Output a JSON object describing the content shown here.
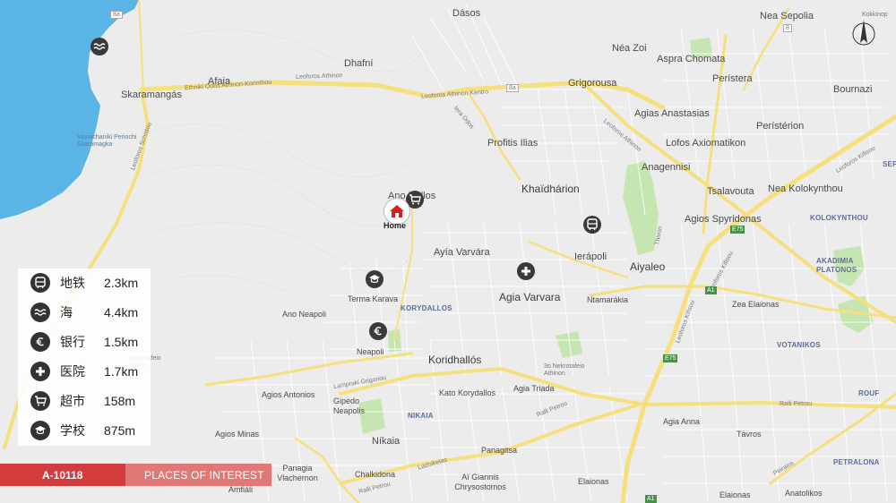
{
  "map": {
    "home_label": "Home",
    "colors": {
      "land": "#ececec",
      "sea": "#5bb4e6",
      "road": "#f6e07e",
      "park": "#bfe3a8",
      "accent": "#d23c3c"
    },
    "places": {
      "dasos": "Dásos",
      "nea_sepolia": "Nea Sepolia",
      "kokkinopilos": "Kokkinop",
      "dafni": "Dhafní",
      "nea_zoi": "Néa Zoi",
      "aspra_chomata": "Aspra Chomata",
      "afaia": "Afaia",
      "skaramangas": "Skaramangás",
      "peristera": "Perístera",
      "bournazi": "Bournazi",
      "grigorousa": "Grigorousa",
      "agias_anastasias": "Agias Anastasias",
      "peristerion": "Perístérion",
      "profitis_ilias": "Profitis Ilias",
      "lofos_axiomatikon": "Lofos Axiomatikon",
      "anagennisi": "Anagennisi",
      "khaidharion": "Khaïdhárion",
      "ano_dallos": "Ano Dallos",
      "tsalavouta": "Tsalavouta",
      "nea_kolokynthou": "Nea Kolokynthou",
      "agios_spyridonas": "Agios Spyridonas",
      "kolokynthou": "KOLOKYNTHOU",
      "ayia_varvara": "Ayía Varvára",
      "ierapoli": "Ierápoli",
      "aiyaleo": "Aiyaleo",
      "akadimia_platonos": "AKADIMIA PLATONOS",
      "agia_varvara": "Agia Varvara",
      "terma_karava": "Terma Karava",
      "korydallos": "KORYDALLOS",
      "ntamarakia": "Ntamarákia",
      "ano_neapoli": "Ano Neapoli",
      "zea_elaionas": "Zea Elaionas",
      "votanikos": "VOTANIKOS",
      "neapoli": "Neapoli",
      "koridhallos": "Koridhallós",
      "nekrotafeio_parko": "Nekrotafeio Parko",
      "nekrotafeio_athinon": "3o Nekrotafeio Athinon",
      "agios_antonios": "Agios Antonios",
      "kato_korydallos": "Kato Korydallos",
      "agia_triada": "Agia Triada",
      "gipedo_neapolis": "Gipedo Neapolis",
      "nikaia_district": "NIKAIA",
      "rouf": "ROUF",
      "agia_anna": "Agia Anna",
      "agios_minas": "Agios Minas",
      "tavros": "Távros",
      "nikaia": "Níkaia",
      "panagitsa": "Panagitsa",
      "petralona": "PETRALONA",
      "panagia_vlachernon": "Panagia Vlachernon",
      "chalkidona": "Chalkidona",
      "ai_giannis": "Aï Giannis Chrysostomos",
      "elaionas": "Elaionas",
      "amfiali": "Amfiáli",
      "elaionas_2": "Elaionas",
      "anatolikos": "Anatolikos",
      "viomichaniki": "Viomichaniki Periochi Skaramagka",
      "sepolia": "SEPO"
    },
    "roads": {
      "ethniki_odos": "Ethniki Odos Athinon-Korinthou",
      "leoforos_athinon": "Leoforos Athinon",
      "leoforos_athinon_kentro": "Leoforos Athinon Kentro",
      "leoforos_schistou": "Leoforos Schistou",
      "leoforos_athinon_2": "Leoforos Athinon",
      "leoforos_kifisou": "Leoforos Kifisou",
      "leoforos_kifisou_2": "Leoforos Kifisou",
      "leoforos_kifisou_3": "Leoforos Kifisou",
      "ierа_odos": "Iera Odos",
      "thivon": "Thivon",
      "lampraki": "Lampraki Grigoriou",
      "ralli_petrou": "Ralli Petrou",
      "ralli_petrou_2": "Ralli Petrou",
      "ralli_petrou_3": "Ralli Petrou",
      "ladoikeias": "Ladoikeias",
      "peiraios": "Peiraios",
      "e75": "E75",
      "e75_b": "E75",
      "a1": "A1",
      "a1_b": "A1",
      "a1_c": "A1",
      "route_8": "8",
      "route_8a": "8a",
      "route_8a_b": "8a"
    }
  },
  "poi_panel": {
    "rows": [
      {
        "icon": "metro-icon",
        "name": "地铁",
        "distance": "2.3km"
      },
      {
        "icon": "sea-icon",
        "name": "海",
        "distance": "4.4km"
      },
      {
        "icon": "bank-icon",
        "name": "银行",
        "distance": "1.5km"
      },
      {
        "icon": "hospital-icon",
        "name": "医院",
        "distance": "1.7km"
      },
      {
        "icon": "supermarket-icon",
        "name": "超市",
        "distance": "158m"
      },
      {
        "icon": "school-icon",
        "name": "学校",
        "distance": "875m"
      }
    ]
  },
  "banner": {
    "ref_code": "A-10118",
    "title": "PLACES OF INTEREST"
  }
}
